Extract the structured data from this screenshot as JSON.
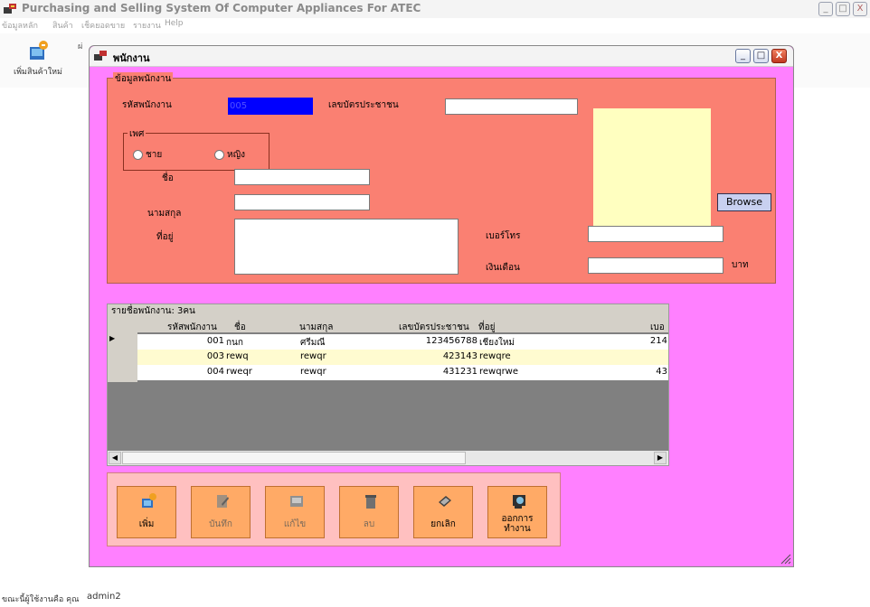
{
  "app": {
    "title": "Purchasing and Selling System  Of Computer Appliances For ATEC",
    "window_buttons": [
      "_",
      "□",
      "X"
    ]
  },
  "menu": [
    {
      "label": "ข้อมูลหลัก"
    },
    {
      "label": "สินค้า"
    },
    {
      "label": "เช็คยอดขาย"
    },
    {
      "label": "รายงาน"
    },
    {
      "label": "Help"
    }
  ],
  "toolbar": {
    "add_product_label": "เพิ่มสินค้าใหม่",
    "add_product_icon": "add-product-icon"
  },
  "employee_window": {
    "title": "พนักงาน",
    "buttons": [
      "_",
      "□",
      "X"
    ],
    "info_group": {
      "caption": "ข้อมูลพนักงาน",
      "emp_code_label": "รหัสพนักงาน",
      "emp_code_value": "005",
      "id_card_label": "เลขบัตรประชาชน",
      "id_card_value": "",
      "gender_caption": "เพศ",
      "gender_male": "ชาย",
      "gender_female": "หญิง",
      "name_label": "ชื่อ",
      "name_value": "",
      "surname_label": "นามสกุล",
      "surname_value": "",
      "address_label": "ที่อยู่",
      "address_value": "",
      "phone_label": "เบอร์โทร",
      "phone_value": "",
      "salary_label": "เงินเดือน",
      "salary_value": "",
      "salary_unit": "บาท",
      "browse_label": "Browse"
    },
    "grid": {
      "caption": "รายชื่อพนักงาน: 3คน",
      "columns": [
        "รหัสพนักงาน",
        "ชื่อ",
        "นามสกุล",
        "เลขบัตรประชาชน",
        "ที่อยู่",
        "เบอ"
      ],
      "rows": [
        {
          "code": "001",
          "name": "กนก",
          "surname": "ศรีมณี",
          "id_card": "123456788",
          "address": "เชียงใหม่",
          "phone": "214"
        },
        {
          "code": "003",
          "name": "rewq",
          "surname": "rewqr",
          "id_card": "423143",
          "address": "rewqre",
          "phone": ""
        },
        {
          "code": "004",
          "name": "rweqr",
          "surname": "rewqr",
          "id_card": "431231",
          "address": "rewqrwe",
          "phone": "43"
        }
      ],
      "current_row_marker": "▶"
    },
    "actions": [
      {
        "label": "เพิ่ม",
        "icon": "add-icon",
        "enabled": true
      },
      {
        "label": "บันทึก",
        "icon": "save-icon",
        "enabled": false
      },
      {
        "label": "แก้ไข",
        "icon": "edit-icon",
        "enabled": false
      },
      {
        "label": "ลบ",
        "icon": "delete-icon",
        "enabled": false
      },
      {
        "label": "ยกเลิก",
        "icon": "cancel-icon",
        "enabled": true
      },
      {
        "label": "ออกการทำงาน",
        "icon": "exit-icon",
        "enabled": true
      }
    ]
  },
  "status": {
    "label": "ขณะนี้ผู้ใช้งานคือ คุณ",
    "user": "admin2"
  },
  "colors": {
    "window_bg": "#ff80ff",
    "group_bg": "#fa8072",
    "photo_bg": "#ffffc0",
    "button_bg": "#ffaa66",
    "panel_bg": "#ffc0c0"
  }
}
